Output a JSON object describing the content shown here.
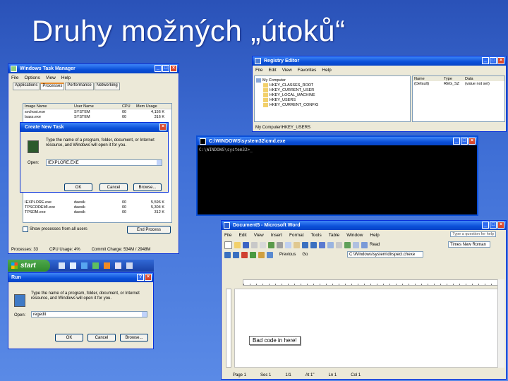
{
  "slide": {
    "title": "Druhy možných „útoků“"
  },
  "task_manager": {
    "title": "Windows Task Manager",
    "menu": [
      "File",
      "Options",
      "View",
      "Help"
    ],
    "tabs": [
      "Applications",
      "Processes",
      "Performance",
      "Networking"
    ],
    "columns": [
      "Image Name",
      "User Name",
      "CPU",
      "Mem Usage"
    ],
    "rows_top": [
      [
        "svchost.exe",
        "SYSTEM",
        "00",
        "4,156 K"
      ],
      [
        "lsass.exe",
        "SYSTEM",
        "00",
        "316 K"
      ]
    ],
    "rows_bottom": [
      [
        "IEXPLORE.exe",
        "daesik",
        "00",
        "5,596 K"
      ],
      [
        "TPSCODEMI.exe",
        "daesik",
        "00",
        "5,304 K"
      ],
      [
        "TPSDM.exe",
        "daesik",
        "00",
        "312 K"
      ]
    ],
    "show_all": "Show processes from all users",
    "end_process": "End Process",
    "status": [
      "Processes: 33",
      "CPU Usage: 4%",
      "Commit Charge: 534M / 2948M"
    ]
  },
  "create_task": {
    "title": "Create New Task",
    "desc": "Type the name of a program, folder, document, or Internet resource, and Windows will open it for you.",
    "open_label": "Open:",
    "open_value": "IEXPLORE.EXE",
    "ok": "OK",
    "cancel": "Cancel",
    "browse": "Browse..."
  },
  "taskbar": {
    "start": "start"
  },
  "run": {
    "title": "Run",
    "desc": "Type the name of a program, folder, document, or Internet resource, and Windows will open it for you.",
    "open_label": "Open:",
    "open_value": "regedit",
    "ok": "OK",
    "cancel": "Cancel",
    "browse": "Browse..."
  },
  "registry": {
    "title": "Registry Editor",
    "menu": [
      "File",
      "Edit",
      "View",
      "Favorites",
      "Help"
    ],
    "tree": [
      "My Computer",
      "HKEY_CLASSES_ROOT",
      "HKEY_CURRENT_USER",
      "HKEY_LOCAL_MACHINE",
      "HKEY_USERS",
      "HKEY_CURRENT_CONFIG"
    ],
    "columns": [
      "Name",
      "Type",
      "Data"
    ],
    "value_row": [
      "(Default)",
      "REG_SZ",
      "(value not set)"
    ],
    "status": "My Computer\\HKEY_USERS"
  },
  "cmd": {
    "title": "C:\\WINDOWS\\system32\\cmd.exe",
    "prompt": "C:\\WINDOWS\\system32>_"
  },
  "word": {
    "title": "Document5 - Microsoft Word",
    "menu": [
      "File",
      "Edit",
      "View",
      "Insert",
      "Format",
      "Tools",
      "Table",
      "Window",
      "Help"
    ],
    "help_box": "Type a question for help",
    "read_btn": "Read",
    "font": "Times New Roman",
    "previous": "Previous",
    "go": "Go",
    "address": "C:\\Windows\\system\\dirspect.chexe",
    "note": "Bad code in here!",
    "status": [
      "Page 1",
      "Sec 1",
      "1/1",
      "At 1\"",
      "Ln 1",
      "Col 1"
    ]
  }
}
